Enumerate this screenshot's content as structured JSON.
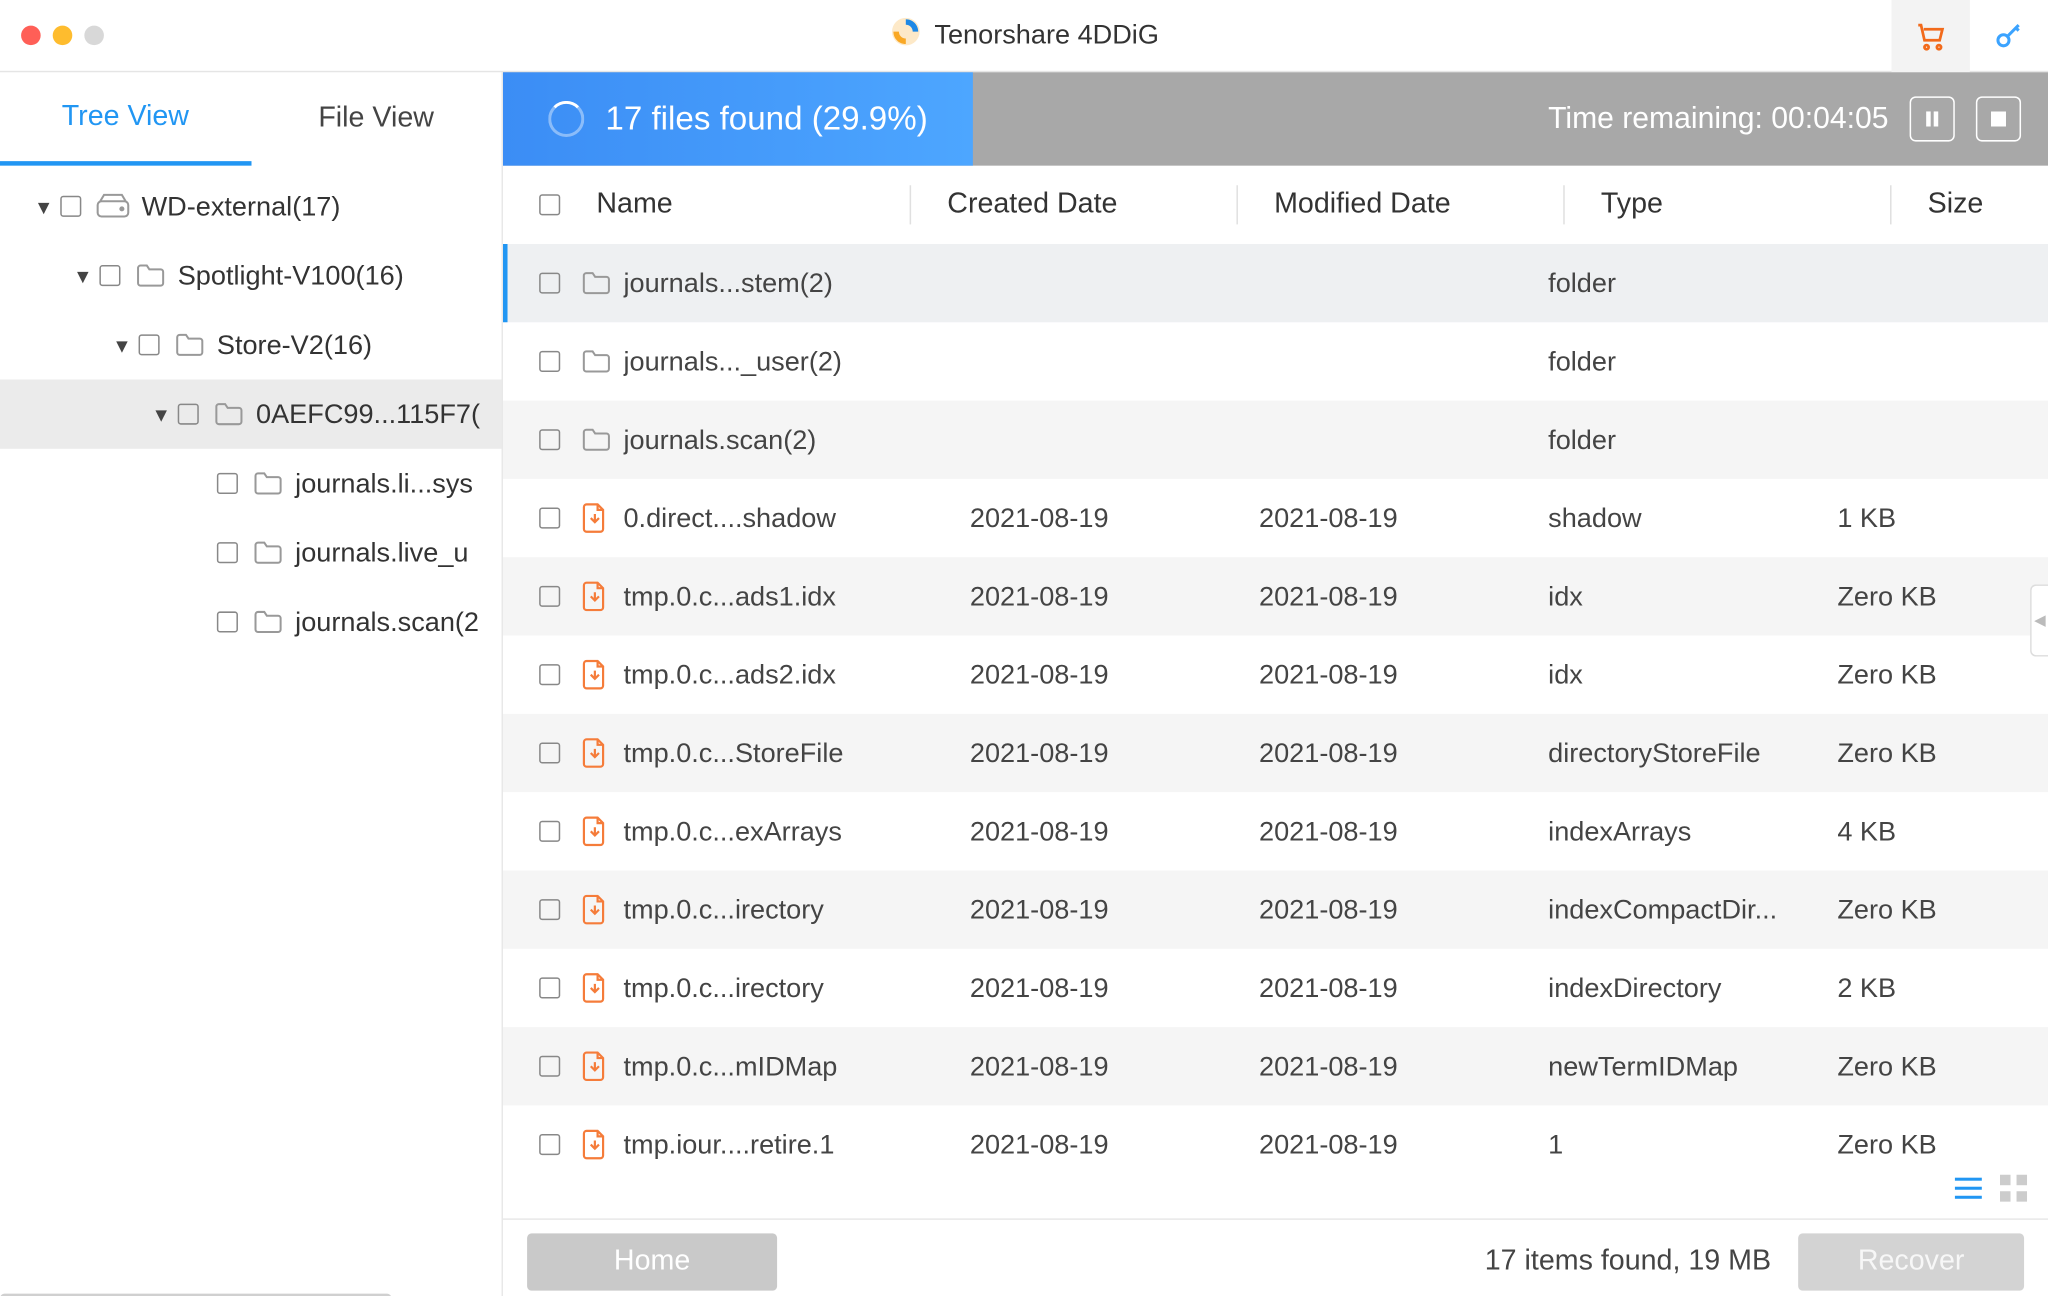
{
  "title": "Tenorshare 4DDiG",
  "tabs": {
    "tree": "Tree View",
    "file": "File View"
  },
  "scan": {
    "status": "17 files found (29.9%)",
    "remaining": "Time remaining: 00:04:05"
  },
  "tree": [
    {
      "indent": 0,
      "chev": true,
      "icon": "disk",
      "label": "WD-external(17)"
    },
    {
      "indent": 1,
      "chev": true,
      "icon": "folder",
      "label": "Spotlight-V100(16)"
    },
    {
      "indent": 2,
      "chev": true,
      "icon": "folder",
      "label": "Store-V2(16)"
    },
    {
      "indent": 3,
      "chev": true,
      "icon": "folder",
      "label": "0AEFC99...115F7(",
      "selected": true
    },
    {
      "indent": 4,
      "chev": false,
      "icon": "folder",
      "label": "journals.li...sys"
    },
    {
      "indent": 4,
      "chev": false,
      "icon": "folder",
      "label": "journals.live_u"
    },
    {
      "indent": 4,
      "chev": false,
      "icon": "folder",
      "label": "journals.scan(2"
    }
  ],
  "columns": {
    "name": "Name",
    "created": "Created Date",
    "modified": "Modified Date",
    "type": "Type",
    "size": "Size"
  },
  "rows": [
    {
      "icon": "folder",
      "name": "journals...stem(2)",
      "created": "",
      "modified": "",
      "type": "folder",
      "size": "",
      "selected": true
    },
    {
      "icon": "folder",
      "name": "journals..._user(2)",
      "created": "",
      "modified": "",
      "type": "folder",
      "size": ""
    },
    {
      "icon": "folder",
      "name": "journals.scan(2)",
      "created": "",
      "modified": "",
      "type": "folder",
      "size": ""
    },
    {
      "icon": "file",
      "name": "0.direct....shadow",
      "created": "2021-08-19",
      "modified": "2021-08-19",
      "type": "shadow",
      "size": "1 KB"
    },
    {
      "icon": "file",
      "name": "tmp.0.c...ads1.idx",
      "created": "2021-08-19",
      "modified": "2021-08-19",
      "type": "idx",
      "size": "Zero KB"
    },
    {
      "icon": "file",
      "name": "tmp.0.c...ads2.idx",
      "created": "2021-08-19",
      "modified": "2021-08-19",
      "type": "idx",
      "size": "Zero KB"
    },
    {
      "icon": "file",
      "name": "tmp.0.c...StoreFile",
      "created": "2021-08-19",
      "modified": "2021-08-19",
      "type": "directoryStoreFile",
      "size": "Zero KB"
    },
    {
      "icon": "file",
      "name": "tmp.0.c...exArrays",
      "created": "2021-08-19",
      "modified": "2021-08-19",
      "type": "indexArrays",
      "size": "4 KB"
    },
    {
      "icon": "file",
      "name": "tmp.0.c...irectory",
      "created": "2021-08-19",
      "modified": "2021-08-19",
      "type": "indexCompactDir...",
      "size": "Zero KB"
    },
    {
      "icon": "file",
      "name": "tmp.0.c...irectory",
      "created": "2021-08-19",
      "modified": "2021-08-19",
      "type": "indexDirectory",
      "size": "2 KB"
    },
    {
      "icon": "file",
      "name": "tmp.0.c...mIDMap",
      "created": "2021-08-19",
      "modified": "2021-08-19",
      "type": "newTermIDMap",
      "size": "Zero KB"
    },
    {
      "icon": "file",
      "name": "tmp.iour....retire.1",
      "created": "2021-08-19",
      "modified": "2021-08-19",
      "type": "1",
      "size": "Zero KB"
    }
  ],
  "footer": {
    "home": "Home",
    "recover": "Recover",
    "status": "17 items found, 19 MB"
  }
}
